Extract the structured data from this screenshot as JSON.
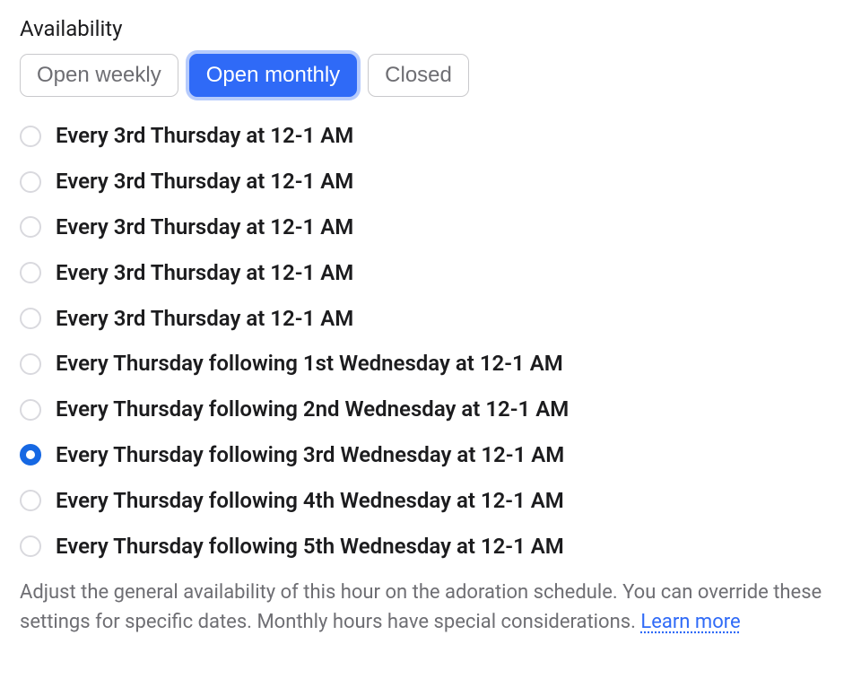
{
  "title": "Availability",
  "tabs": [
    {
      "label": "Open weekly",
      "active": false
    },
    {
      "label": "Open monthly",
      "active": true
    },
    {
      "label": "Closed",
      "active": false
    }
  ],
  "options": [
    {
      "label": "Every 3rd Thursday at 12-1 AM",
      "selected": false
    },
    {
      "label": "Every 3rd Thursday at 12-1 AM",
      "selected": false
    },
    {
      "label": "Every 3rd Thursday at 12-1 AM",
      "selected": false
    },
    {
      "label": "Every 3rd Thursday at 12-1 AM",
      "selected": false
    },
    {
      "label": "Every 3rd Thursday at 12-1 AM",
      "selected": false
    },
    {
      "label": "Every Thursday following 1st Wednesday at 12-1 AM",
      "selected": false
    },
    {
      "label": "Every Thursday following 2nd Wednesday at 12-1 AM",
      "selected": false
    },
    {
      "label": "Every Thursday following 3rd Wednesday at 12-1 AM",
      "selected": true
    },
    {
      "label": "Every Thursday following 4th Wednesday at 12-1 AM",
      "selected": false
    },
    {
      "label": "Every Thursday following 5th Wednesday at 12-1 AM",
      "selected": false
    }
  ],
  "help": {
    "text": "Adjust the general availability of this hour on the adoration schedule. You can override these settings for specific dates. Monthly hours have special considerations. ",
    "link": "Learn more"
  }
}
